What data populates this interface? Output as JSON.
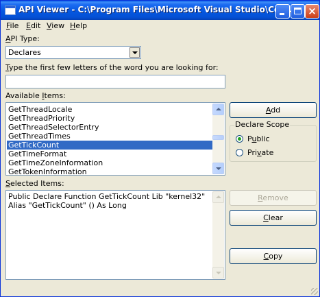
{
  "window": {
    "title": "API Viewer - C:\\Program Files\\Microsoft Visual Studio\\Com...",
    "buttons": {
      "minimize": "minimize",
      "maximize": "maximize",
      "close": "×"
    }
  },
  "menu": [
    {
      "underline": "F",
      "rest": "ile"
    },
    {
      "underline": "E",
      "rest": "dit"
    },
    {
      "underline": "V",
      "rest": "iew"
    },
    {
      "underline": "H",
      "rest": "elp"
    }
  ],
  "api_type": {
    "label_u": "A",
    "label_rest": "PI Type:",
    "selected": "Declares"
  },
  "search": {
    "label_u": "T",
    "label_rest": "ype the first few letters of the word you are looking for:",
    "value": ""
  },
  "available": {
    "label_pre": "Available ",
    "label_u": "I",
    "label_rest": "tems:",
    "items": [
      "GetThreadLocale",
      "GetThreadPriority",
      "GetThreadSelectorEntry",
      "GetThreadTimes",
      "GetTickCount",
      "GetTimeFormat",
      "GetTimeZoneInformation",
      "GetTokenInformation"
    ],
    "selected_index": 4
  },
  "selected_items": {
    "label_u": "S",
    "label_rest": "elected Items:",
    "text": "Public Declare Function GetTickCount Lib \"kernel32\" Alias \"GetTickCount\" () As Long"
  },
  "buttons": {
    "add": {
      "u": "A",
      "rest": "dd"
    },
    "remove": {
      "u": "R",
      "rest": "emove"
    },
    "clear": {
      "u": "C",
      "rest": "lear"
    },
    "copy": {
      "u": "C",
      "rest": "opy"
    }
  },
  "declare_scope": {
    "title": "Declare Scope",
    "options": [
      {
        "pre": "P",
        "u": "u",
        "rest": "blic",
        "checked": true
      },
      {
        "pre": "Pri",
        "u": "v",
        "rest": "ate",
        "checked": false
      }
    ]
  }
}
